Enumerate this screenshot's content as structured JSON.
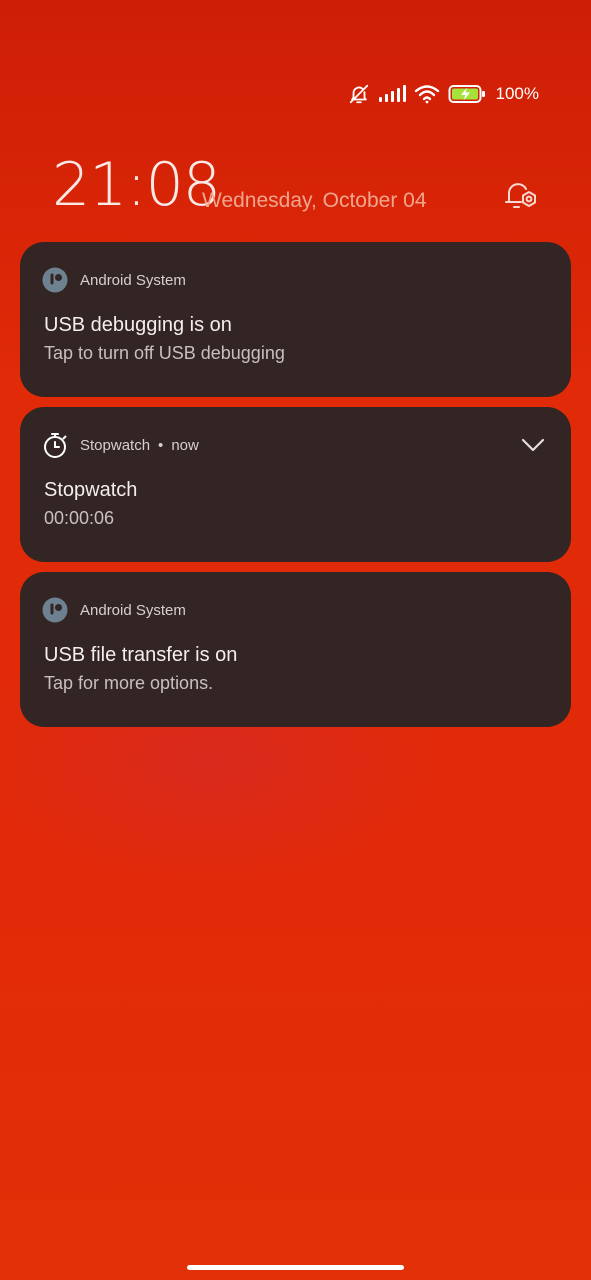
{
  "status_bar": {
    "icons": [
      "bell-off-icon",
      "signal-icon",
      "wifi-icon",
      "battery-charging-icon"
    ],
    "battery_percent": "100%"
  },
  "lockscreen": {
    "time": "21:08",
    "date": "Wednesday, October 04",
    "settings_icon": "notification-settings-icon"
  },
  "notifications": [
    {
      "app": "Android System",
      "icon": "android-system-icon",
      "title": "USB debugging is on",
      "body": "Tap to turn off USB debugging"
    },
    {
      "app": "Stopwatch",
      "icon": "stopwatch-icon",
      "separator": "•",
      "time": "now",
      "title": "Stopwatch",
      "body": "00:00:06",
      "expand_icon": "chevron-down-icon"
    },
    {
      "app": "Android System",
      "icon": "android-system-icon",
      "title": "USB file transfer is on",
      "body": "Tap for more options."
    }
  ],
  "colors": {
    "background": "#e02a08",
    "card": "#322523",
    "date_text": "#f3a58e",
    "battery_green": "#a6e23b"
  }
}
